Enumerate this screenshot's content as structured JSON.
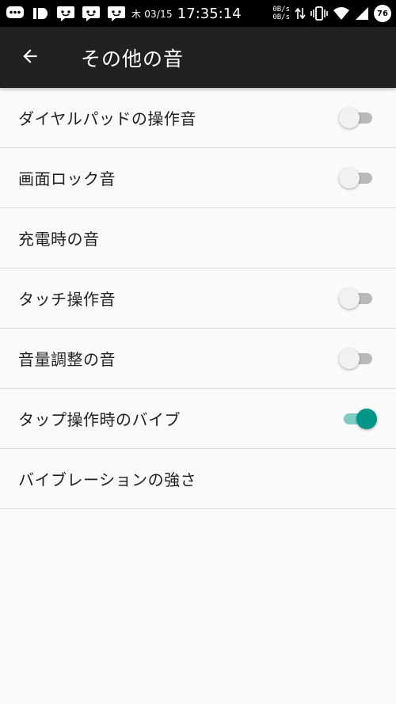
{
  "status_bar": {
    "date": "木 03/15",
    "time": "17:35:14",
    "net_up": "0B/s",
    "net_down": "0B/s",
    "battery": "76",
    "notification_icons": [
      "chat-bubble-icon",
      "id-icon",
      "messenger-icon",
      "messenger-icon",
      "messenger-icon"
    ]
  },
  "app_bar": {
    "title": "その他の音"
  },
  "settings": [
    {
      "label": "ダイヤルパッドの操作音",
      "toggle": true,
      "checked": false
    },
    {
      "label": "画面ロック音",
      "toggle": true,
      "checked": false
    },
    {
      "label": "充電時の音",
      "toggle": false
    },
    {
      "label": "タッチ操作音",
      "toggle": true,
      "checked": false
    },
    {
      "label": "音量調整の音",
      "toggle": true,
      "checked": false
    },
    {
      "label": "タップ操作時のバイブ",
      "toggle": true,
      "checked": true
    },
    {
      "label": "バイブレーションの強さ",
      "toggle": false
    }
  ],
  "colors": {
    "accent": "#009688",
    "accent_track": "#80cbc4",
    "app_bar": "#212121",
    "background": "#fafafa"
  }
}
